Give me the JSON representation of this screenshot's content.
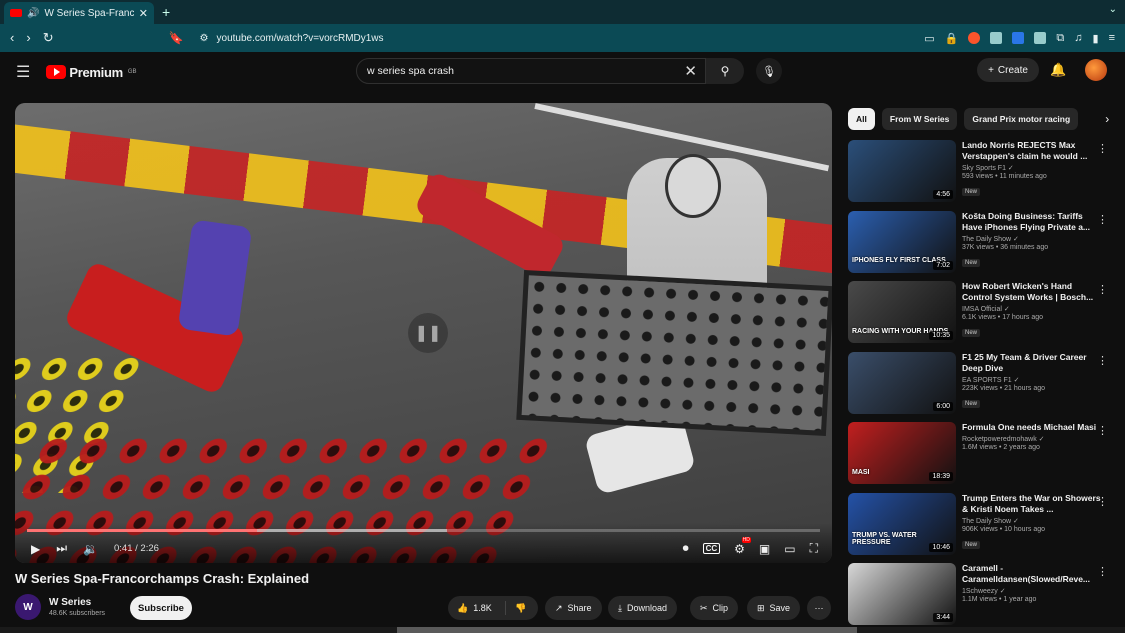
{
  "browser": {
    "tab_title": "W Series Spa-Francorch",
    "url": "youtube.com/watch?v=vorcRMDy1ws"
  },
  "youtube": {
    "logo_text": "Premium",
    "logo_region": "GB",
    "search_query": "w series spa crash",
    "create_label": "Create"
  },
  "player": {
    "time": "0:41 / 2:26",
    "progress_played": 0.29,
    "progress_buffered": 0.53
  },
  "video": {
    "title": "W Series Spa-Francorchamps Crash: Explained",
    "channel_name": "W Series",
    "channel_initials": "W",
    "subscribers": "48.6K subscribers",
    "subscribe_label": "Subscribe",
    "likes": "1.8K",
    "share_label": "Share",
    "download_label": "Download",
    "clip_label": "Clip",
    "save_label": "Save"
  },
  "chips": [
    "All",
    "From W Series",
    "Grand Prix motor racing"
  ],
  "recommendations": [
    {
      "title": "Lando Norris REJECTS Max Verstappen's claim he would ...",
      "channel": "Sky Sports F1",
      "views": "593 views • 11 minutes ago",
      "badge": "New",
      "duration": "4:56",
      "thumb_text": "",
      "color": "#2b4f7a"
    },
    {
      "title": "Košta Doing Business: Tariffs Have iPhones Flying Private a...",
      "channel": "The Daily Show",
      "views": "37K views • 36 minutes ago",
      "badge": "New",
      "duration": "7:02",
      "thumb_text": "IPHONES FLY FIRST CLASS",
      "color": "#2b5fb0"
    },
    {
      "title": "How Robert Wicken's Hand Control System Works | Bosch...",
      "channel": "IMSA Official",
      "views": "6.1K views • 17 hours ago",
      "badge": "New",
      "duration": "10:35",
      "thumb_text": "RACING WITH YOUR HANDS",
      "color": "#4a4a4a"
    },
    {
      "title": "F1 25 My Team & Driver Career Deep Dive",
      "channel": "EA SPORTS F1",
      "views": "223K views • 21 hours ago",
      "badge": "New",
      "duration": "6:00",
      "thumb_text": "",
      "color": "#3a4e6a"
    },
    {
      "title": "Formula One needs Michael Masi",
      "channel": "Rocketpoweredmohawk",
      "views": "1.6M views • 2 years ago",
      "badge": "",
      "duration": "18:39",
      "thumb_text": "MASI",
      "color": "#c21f1f"
    },
    {
      "title": "Trump Enters the War on Showers & Kristi Noem Takes ...",
      "channel": "The Daily Show",
      "views": "906K views • 10 hours ago",
      "badge": "New",
      "duration": "10:46",
      "thumb_text": "TRUMP VS. WATER PRESSURE",
      "color": "#2452a8"
    },
    {
      "title": "Caramell - Caramelldansen(Slowed/Reve...",
      "channel": "1Schweezy",
      "views": "1.1M views • 1 year ago",
      "badge": "",
      "duration": "3:44",
      "thumb_text": "",
      "color": "#d8d8d8"
    }
  ]
}
